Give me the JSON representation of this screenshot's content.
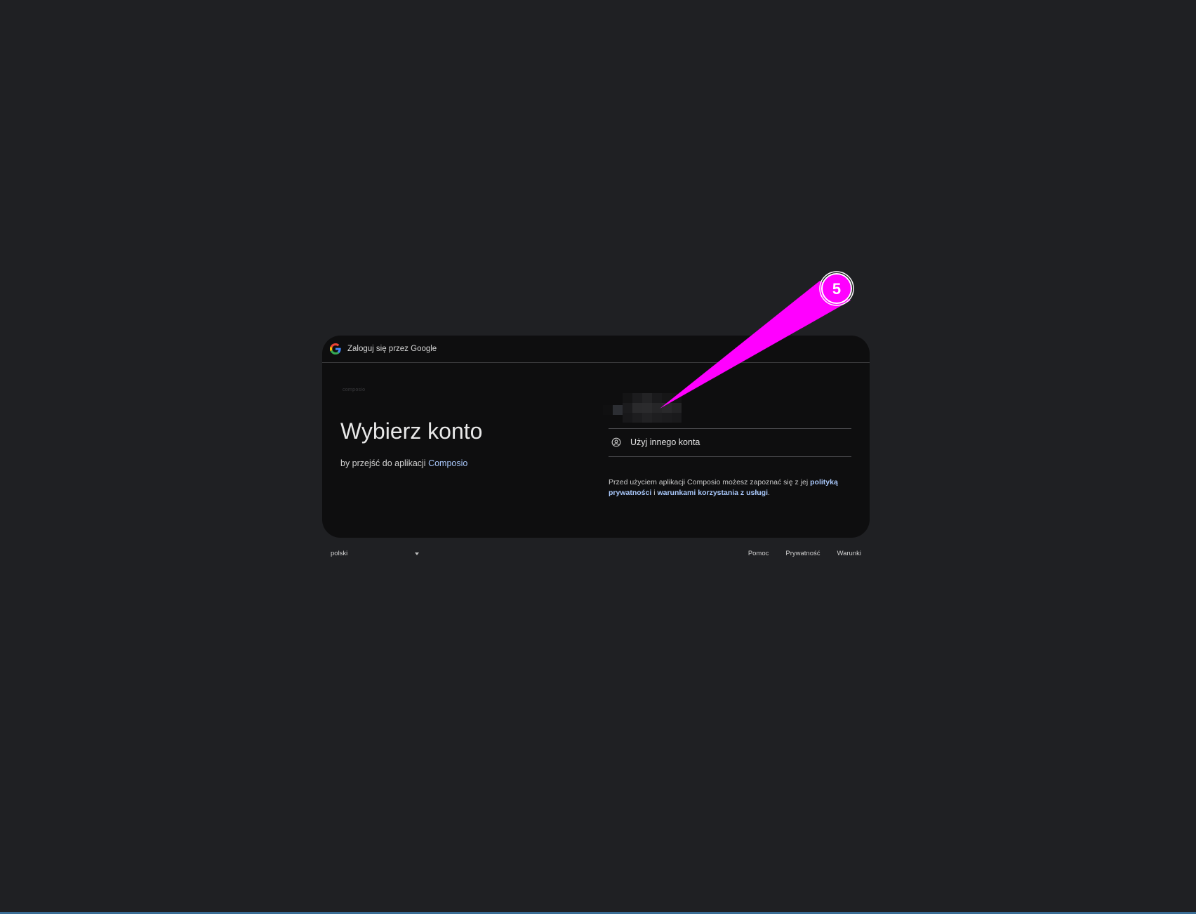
{
  "header": {
    "title": "Zaloguj się przez Google",
    "logo_icon": "google-g-icon"
  },
  "main": {
    "app_logo_text": "composio",
    "title": "Wybierz konto",
    "subtitle_prefix": "by przejść do aplikacji ",
    "app_name": "Composio",
    "use_other_account_label": "Użyj innego konta",
    "use_other_account_icon": "account-circle-icon",
    "disclaimer": {
      "prefix": "Przed użyciem aplikacji Composio możesz zapoznać się z jej ",
      "privacy_link": "polityką prywatności",
      "middle": " i ",
      "terms_link": "warunkami korzystania z usługi",
      "suffix": "."
    }
  },
  "footer": {
    "language": "polski",
    "links": {
      "help": "Pomoc",
      "privacy": "Prywatność",
      "terms": "Warunki"
    }
  },
  "annotation": {
    "label": "5",
    "color": "#ff00ff"
  },
  "colors": {
    "background": "#1f2023",
    "card": "#0e0e0f",
    "link": "#a8c7fa"
  }
}
